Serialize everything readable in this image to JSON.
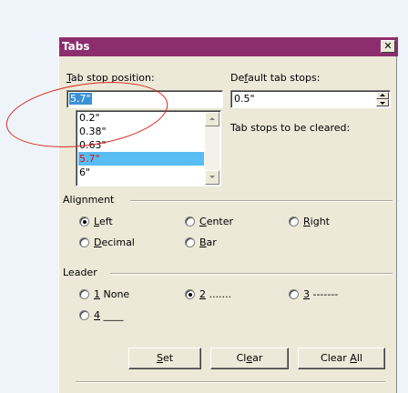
{
  "dialog": {
    "title": "Tabs",
    "close_glyph": "✕"
  },
  "tab_stop_position": {
    "label_prefix": "",
    "label_mnemonic": "T",
    "label_rest": "ab stop position:",
    "value": "5.7\"",
    "list": [
      "0.2\"",
      "0.38\"",
      "0.63\"",
      "5.7\"",
      "6\""
    ],
    "selected_index": 3
  },
  "default_tab_stops": {
    "label_prefix": "De",
    "label_mnemonic": "f",
    "label_rest": "ault tab stops:",
    "value": "0.5\""
  },
  "tab_stops_cleared_label": "Tab stops to be cleared:",
  "alignment": {
    "label": "Alignment",
    "options": [
      {
        "mn": "L",
        "rest": "eft",
        "selected": true
      },
      {
        "mn": "C",
        "rest": "enter",
        "selected": false
      },
      {
        "mn": "R",
        "rest": "ight",
        "selected": false
      },
      {
        "mn": "D",
        "rest": "ecimal",
        "selected": false
      },
      {
        "mn": "B",
        "rest": "ar",
        "selected": false
      }
    ]
  },
  "leader": {
    "label": "Leader",
    "options": [
      {
        "mn": "1",
        "rest": " None",
        "selected": false
      },
      {
        "mn": "2",
        "rest": " .......",
        "selected": true
      },
      {
        "mn": "3",
        "rest": " -------",
        "selected": false
      },
      {
        "mn": "4",
        "rest": " ____",
        "selected": false
      }
    ]
  },
  "buttons": {
    "set": {
      "mn": "S",
      "rest": "et"
    },
    "clear": {
      "pre": "Cl",
      "mn": "e",
      "rest": "ar"
    },
    "clear_all": {
      "pre": "Clear ",
      "mn": "A",
      "rest": "ll"
    }
  },
  "annotation_color": "#d9261c"
}
